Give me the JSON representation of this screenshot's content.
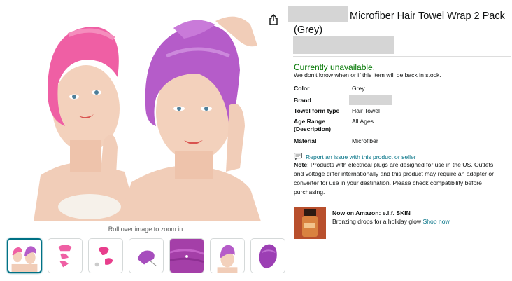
{
  "product": {
    "title": "Microfiber Hair Towel Wrap 2 Pack (Grey)"
  },
  "gallery": {
    "zoom_hint": "Roll over image to zoom in",
    "thumbnails": [
      {
        "name": "thumbnail-1-two-models",
        "selected": true
      },
      {
        "name": "thumbnail-2-folded-towel",
        "selected": false
      },
      {
        "name": "thumbnail-3-pink-towel-steps",
        "selected": false
      },
      {
        "name": "thumbnail-4-purple-towel",
        "selected": false
      },
      {
        "name": "thumbnail-5-fabric-closeup",
        "selected": false
      },
      {
        "name": "thumbnail-6-model-purple",
        "selected": false
      },
      {
        "name": "thumbnail-7-purple-wrap",
        "selected": false
      }
    ]
  },
  "availability": {
    "status": "Currently unavailable.",
    "detail": "We don't know when or if this item will be back in stock."
  },
  "specs": [
    {
      "key": "Color",
      "value": "Grey"
    },
    {
      "key": "Brand",
      "value": ""
    },
    {
      "key": "Towel form type",
      "value": "Hair Towel"
    },
    {
      "key": "Age Range (Description)",
      "value": "All Ages"
    },
    {
      "key": "Material",
      "value": "Microfiber"
    }
  ],
  "report": {
    "label": "Report an issue with this product or seller"
  },
  "note": {
    "label": "Note",
    "text": ": Products with electrical plugs are designed for use in the US. Outlets and voltage differ internationally and this product may require an adapter or converter for use in your destination. Please check compatibility before purchasing."
  },
  "promo": {
    "title": "Now on Amazon: e.l.f. SKIN",
    "text": "Bronzing drops for a holiday glow ",
    "link": "Shop now"
  },
  "icons": {
    "share": "share-icon",
    "report": "comment-icon"
  },
  "colors": {
    "available_green": "#007600",
    "link_teal": "#007185",
    "selected_border": "#007185"
  }
}
